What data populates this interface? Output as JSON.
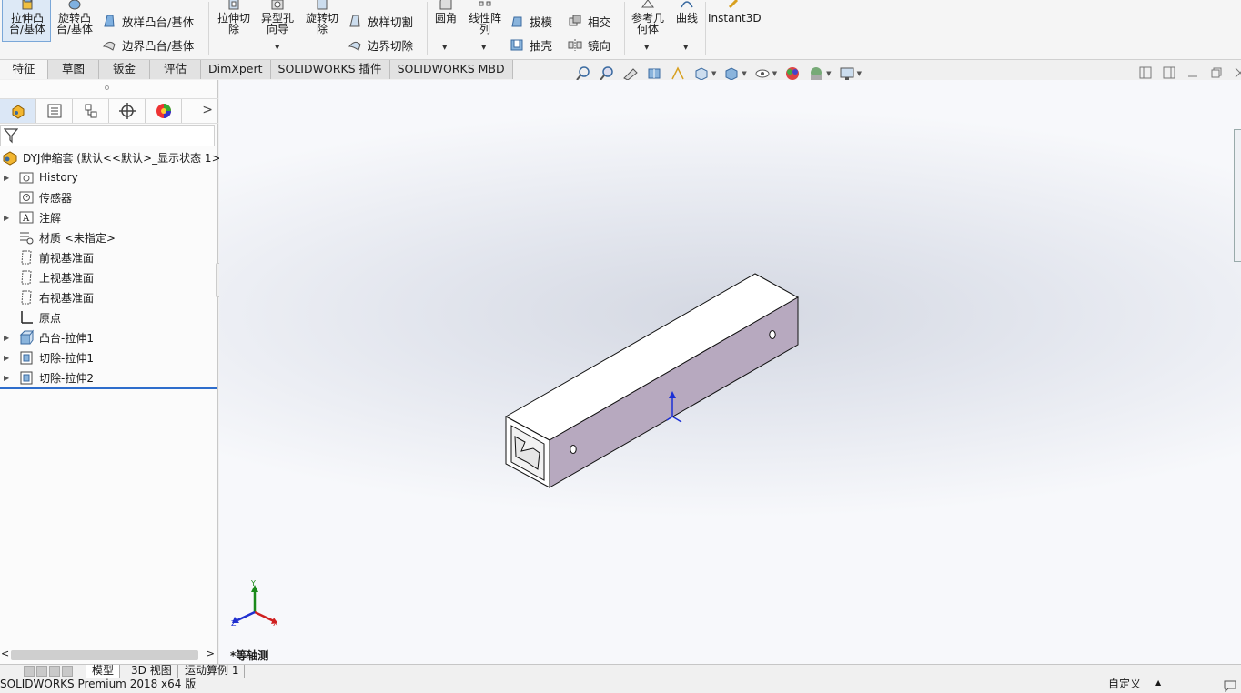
{
  "ribbon": {
    "extrude_boss": "拉伸凸\n台/基体",
    "revolve_boss": "旋转凸\n台/基体",
    "loft_boss": "放样凸台/基体",
    "boundary_boss": "边界凸台/基体",
    "extrude_cut": "拉伸切\n除",
    "hole_wizard": "异型孔\n向导",
    "revolve_cut": "旋转切\n除",
    "loft_cut": "放样切割",
    "boundary_cut": "边界切除",
    "fillet": "圆角",
    "linear_pattern": "线性阵\n列",
    "draft": "拔模",
    "shell": "抽壳",
    "intersect": "相交",
    "mirror": "镜向",
    "reference_geometry": "参考几\n何体",
    "curves": "曲线",
    "instant3d": "Instant3D"
  },
  "command_tabs": [
    "特征",
    "草图",
    "钣金",
    "评估",
    "DimXpert",
    "SOLIDWORKS 插件",
    "SOLIDWORKS MBD"
  ],
  "feature_tree": {
    "root": "DYJ伸缩套  (默认<<默认>_显示状态 1>)",
    "items": [
      {
        "label": "History",
        "icon": "history-folder-icon",
        "expand": true
      },
      {
        "label": "传感器",
        "icon": "sensor-icon",
        "expand": false
      },
      {
        "label": "注解",
        "icon": "annotation-icon",
        "expand": true
      },
      {
        "label": "材质 <未指定>",
        "icon": "material-icon",
        "expand": false
      },
      {
        "label": "前视基准面",
        "icon": "plane-icon",
        "expand": false
      },
      {
        "label": "上视基准面",
        "icon": "plane-icon",
        "expand": false
      },
      {
        "label": "右视基准面",
        "icon": "plane-icon",
        "expand": false
      },
      {
        "label": "原点",
        "icon": "origin-icon",
        "expand": false
      },
      {
        "label": "凸台-拉伸1",
        "icon": "boss-extrude-icon",
        "expand": true
      },
      {
        "label": "切除-拉伸1",
        "icon": "cut-extrude-icon",
        "expand": true
      },
      {
        "label": "切除-拉伸2",
        "icon": "cut-extrude-icon",
        "expand": true
      }
    ]
  },
  "viewport": {
    "view_label": "*等轴测",
    "triad": {
      "x": "X",
      "y": "Y",
      "z": "Z"
    }
  },
  "bottom_tabs": [
    "模型",
    "3D 视图",
    "运动算例 1"
  ],
  "status_bar": {
    "product": "SOLIDWORKS Premium 2018 x64 版",
    "units": "自定义"
  },
  "colors": {
    "accent": "#2e6dcc",
    "part_face_side": "#b7a9bf",
    "part_face_top": "#ffffff"
  }
}
